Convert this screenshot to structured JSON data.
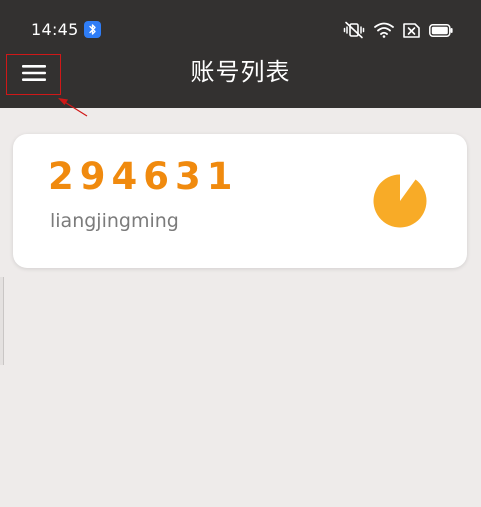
{
  "status_bar": {
    "time": "14:45",
    "icons": [
      "bluetooth-icon",
      "vibrate-mute-icon",
      "wifi-icon",
      "sim-off-icon",
      "battery-icon"
    ]
  },
  "app_bar": {
    "title": "账号列表",
    "menu_icon": "hamburger-menu-icon"
  },
  "accounts": [
    {
      "code": "294631",
      "name": "liangjingming",
      "countdown_remaining_fraction": 0.9
    }
  ],
  "colors": {
    "app_bar_bg": "#333130",
    "page_bg": "#eeebea",
    "code_color": "#f08a0e",
    "pie_color": "#f8ab27",
    "name_color": "#7b7b7b",
    "annotation_red": "#d01818"
  }
}
